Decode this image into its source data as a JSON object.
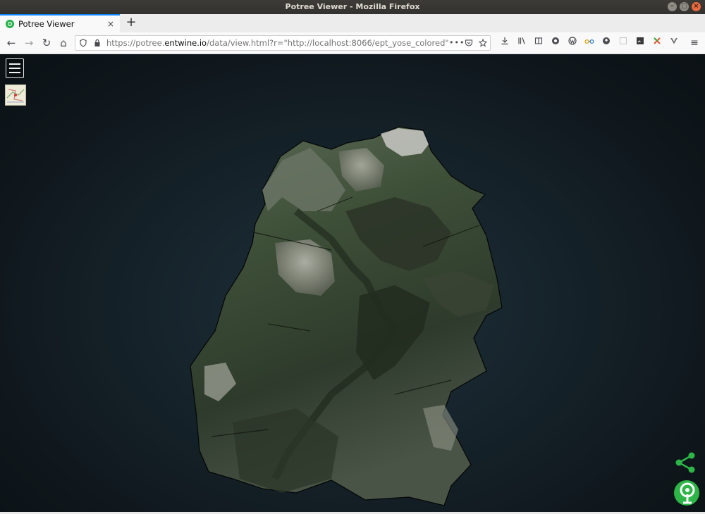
{
  "window": {
    "title": "Potree Viewer - Mozilla Firefox",
    "min_label": "–",
    "max_label": "□",
    "close_label": "×"
  },
  "tabs": [
    {
      "label": "Potree Viewer",
      "close_label": "×"
    }
  ],
  "new_tab_label": "+",
  "nav": {
    "back_label": "←",
    "forward_label": "→",
    "reload_label": "↻",
    "home_label": "⌂",
    "url_prefix": "https://potree.",
    "url_domain": "entwine.io",
    "url_suffix": "/data/view.html?r=\"http://localhost:8066/ept_yose_colored\"",
    "more_label": "•••",
    "menu_label": "≡"
  },
  "icons": {
    "site_info": "shield-icon",
    "lock": "lock-icon",
    "pocket": "pocket-icon",
    "bookmark": "star-icon",
    "toolbar": [
      "download-icon",
      "library-icon",
      "reader-icon",
      "globe-icon",
      "wordpress-icon",
      "glasses-icon",
      "account-icon",
      "blank-icon",
      "selenium-icon",
      "puzzle-icon",
      "vuejs-icon"
    ]
  },
  "viewer": {
    "background_color": "#0f171c",
    "accent_color": "#2db547"
  }
}
